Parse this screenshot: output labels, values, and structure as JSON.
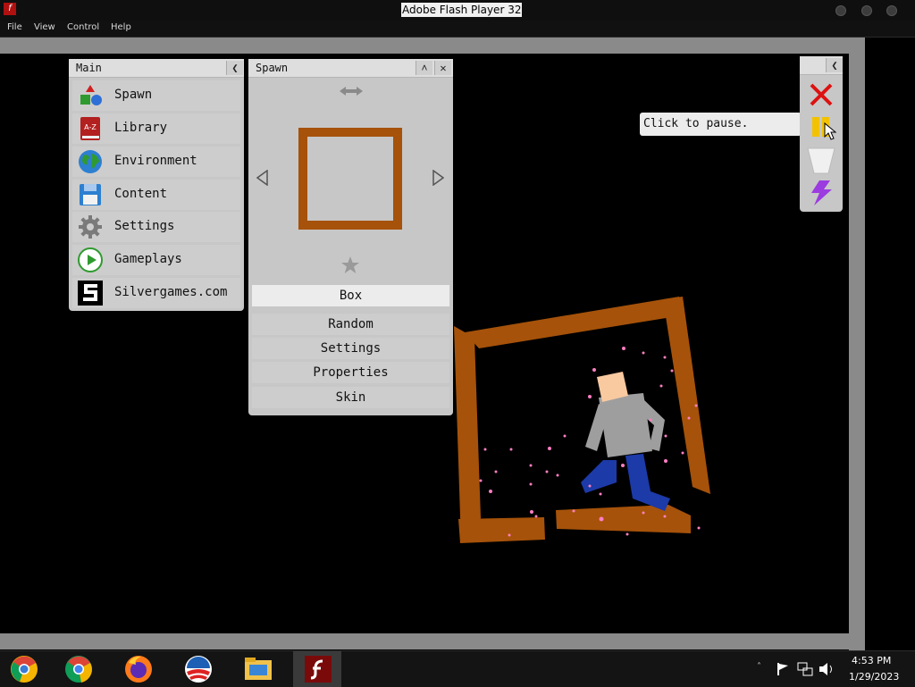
{
  "window": {
    "title": "Adobe Flash Player 32"
  },
  "menu": [
    "File",
    "View",
    "Control",
    "Help"
  ],
  "main_panel": {
    "title": "Main",
    "items": [
      {
        "label": "Spawn",
        "icon": "shapes-icon"
      },
      {
        "label": "Library",
        "icon": "book-icon"
      },
      {
        "label": "Environment",
        "icon": "globe-icon"
      },
      {
        "label": "Content",
        "icon": "floppy-disk-icon"
      },
      {
        "label": "Settings",
        "icon": "gear-icon"
      },
      {
        "label": "Gameplays",
        "icon": "play-icon"
      },
      {
        "label": "Silvergames.com",
        "icon": "silvergames-logo-icon"
      }
    ]
  },
  "spawn_panel": {
    "title": "Spawn",
    "selected": "Box",
    "buttons": [
      "Random",
      "Settings",
      "Properties",
      "Skin"
    ]
  },
  "book_icon_text": "A-Z",
  "tooltip": "Click to pause.",
  "taskbar": {
    "time": "4:53 PM",
    "date": "1/29/2023",
    "apps": [
      "chrome-canary-icon",
      "chrome-icon",
      "firefox-icon",
      "obama-logo-icon",
      "file-explorer-icon",
      "flash-player-icon"
    ]
  },
  "colors": {
    "box": "#a6520a",
    "panel": "#c7c7c7",
    "ragdoll_torso": "#9e9e9e",
    "ragdoll_legs": "#1c3aa8",
    "ragdoll_head": "#f9c9a0"
  }
}
